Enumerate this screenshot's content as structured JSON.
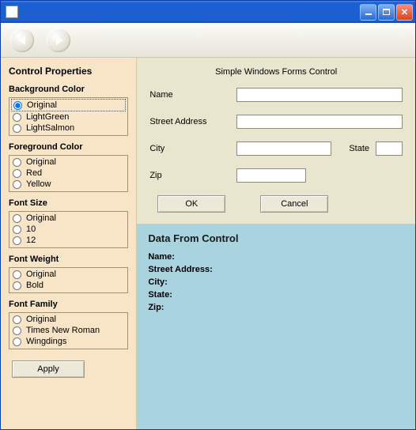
{
  "sidebar": {
    "title": "Control Properties",
    "groups": {
      "bg": {
        "label": "Background Color",
        "options": [
          "Original",
          "LightGreen",
          "LightSalmon"
        ],
        "selected": 0
      },
      "fg": {
        "label": "Foreground Color",
        "options": [
          "Original",
          "Red",
          "Yellow"
        ],
        "selected": -1
      },
      "fs": {
        "label": "Font Size",
        "options": [
          "Original",
          "10",
          "12"
        ],
        "selected": -1
      },
      "fw": {
        "label": "Font Weight",
        "options": [
          "Original",
          "Bold"
        ],
        "selected": -1
      },
      "ff": {
        "label": "Font Family",
        "options": [
          "Original",
          "Times New Roman",
          "Wingdings"
        ],
        "selected": -1
      }
    },
    "apply_label": "Apply"
  },
  "form": {
    "title": "Simple Windows Forms Control",
    "labels": {
      "name": "Name",
      "street": "Street Address",
      "city": "City",
      "state": "State",
      "zip": "Zip"
    },
    "values": {
      "name": "",
      "street": "",
      "city": "",
      "state": "",
      "zip": ""
    },
    "buttons": {
      "ok": "OK",
      "cancel": "Cancel"
    }
  },
  "data": {
    "title": "Data From Control",
    "labels": {
      "name": "Name:",
      "street": "Street Address:",
      "city": "City:",
      "state": "State:",
      "zip": "Zip:"
    },
    "values": {
      "name": "",
      "street": "",
      "city": "",
      "state": "",
      "zip": ""
    }
  }
}
